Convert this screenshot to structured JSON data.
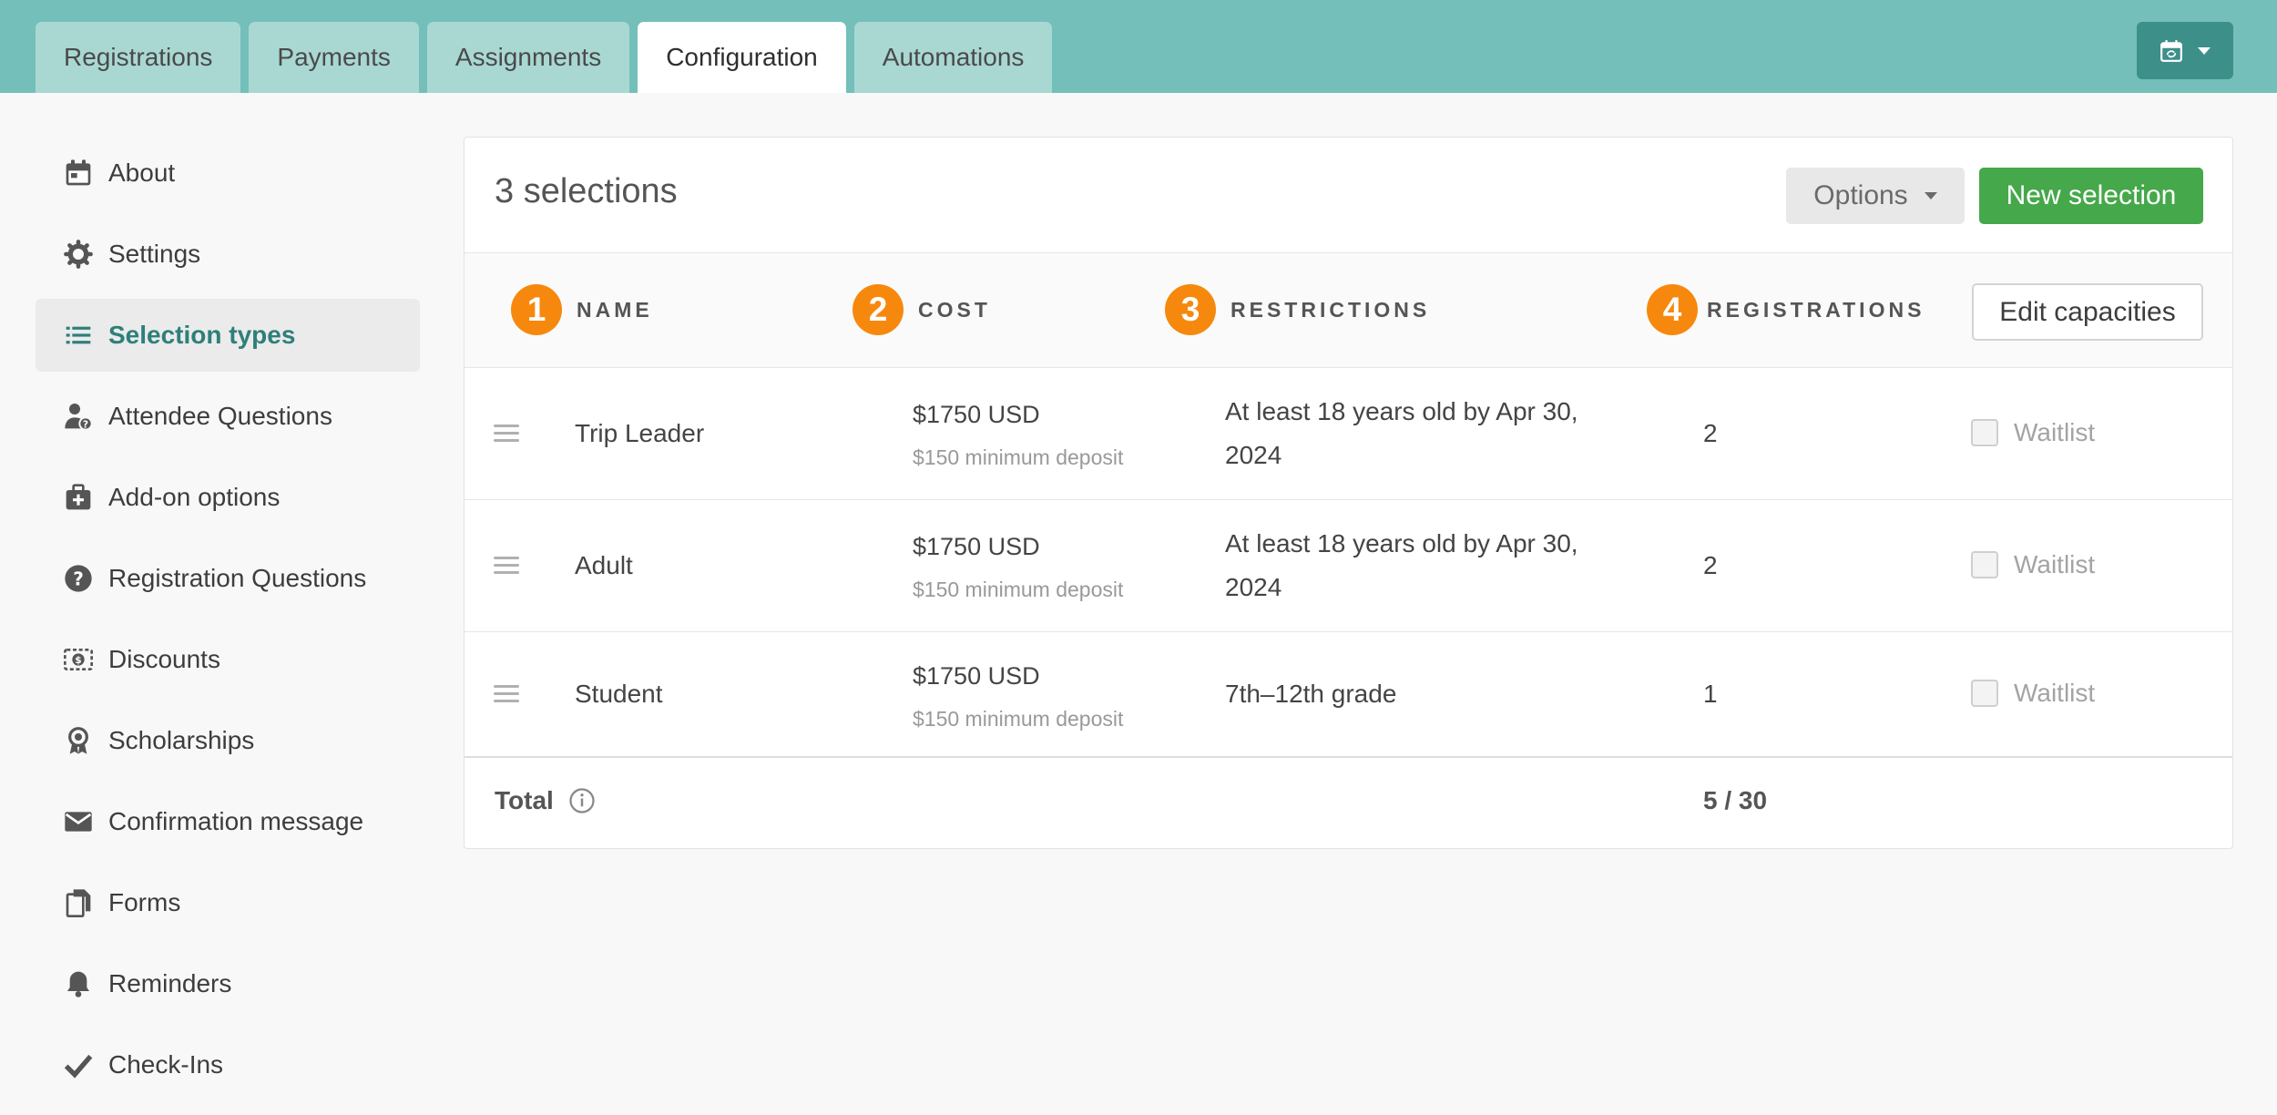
{
  "tabs": [
    {
      "label": "Registrations"
    },
    {
      "label": "Payments"
    },
    {
      "label": "Assignments"
    },
    {
      "label": "Configuration",
      "active": true
    },
    {
      "label": "Automations"
    }
  ],
  "header_button": {
    "icon": "calendar-sync-icon"
  },
  "sidebar": {
    "items": [
      {
        "label": "About",
        "icon": "calendar-icon"
      },
      {
        "label": "Settings",
        "icon": "gear-icon"
      },
      {
        "label": "Selection types",
        "icon": "list-icon",
        "active": true
      },
      {
        "label": "Attendee Questions",
        "icon": "user-question-icon"
      },
      {
        "label": "Add-on options",
        "icon": "briefcase-plus-icon"
      },
      {
        "label": "Registration Questions",
        "icon": "question-circle-icon"
      },
      {
        "label": "Discounts",
        "icon": "discount-icon"
      },
      {
        "label": "Scholarships",
        "icon": "award-icon"
      },
      {
        "label": "Confirmation message",
        "icon": "envelope-icon"
      },
      {
        "label": "Forms",
        "icon": "documents-icon"
      },
      {
        "label": "Reminders",
        "icon": "bell-icon"
      },
      {
        "label": "Check-Ins",
        "icon": "checkmark-icon"
      }
    ]
  },
  "panel": {
    "title": "3 selections",
    "options_label": "Options",
    "new_label": "New selection",
    "edit_capacities_label": "Edit capacities"
  },
  "columns": [
    {
      "num": "1",
      "label": "NAME"
    },
    {
      "num": "2",
      "label": "COST"
    },
    {
      "num": "3",
      "label": "RESTRICTIONS"
    },
    {
      "num": "4",
      "label": "REGISTRATIONS"
    }
  ],
  "rows": [
    {
      "name": "Trip Leader",
      "cost": "$1750 USD",
      "deposit": "$150 minimum deposit",
      "restriction": "At least 18 years old by Apr 30, 2024",
      "registrations": "2",
      "waitlist_label": "Waitlist",
      "waitlist_checked": false
    },
    {
      "name": "Adult",
      "cost": "$1750 USD",
      "deposit": "$150 minimum deposit",
      "restriction": "At least 18 years old by Apr 30, 2024",
      "registrations": "2",
      "waitlist_label": "Waitlist",
      "waitlist_checked": false
    },
    {
      "name": "Student",
      "cost": "$1750 USD",
      "deposit": "$150 minimum deposit",
      "restriction": "7th–12th grade",
      "registrations": "1",
      "waitlist_label": "Waitlist",
      "waitlist_checked": false
    }
  ],
  "total": {
    "label": "Total",
    "value": "5 / 30"
  },
  "colors": {
    "topbar": "#74bfb9",
    "accent": "#2e7f7a",
    "primary_button": "#45a84a",
    "badge": "#f6890d"
  }
}
